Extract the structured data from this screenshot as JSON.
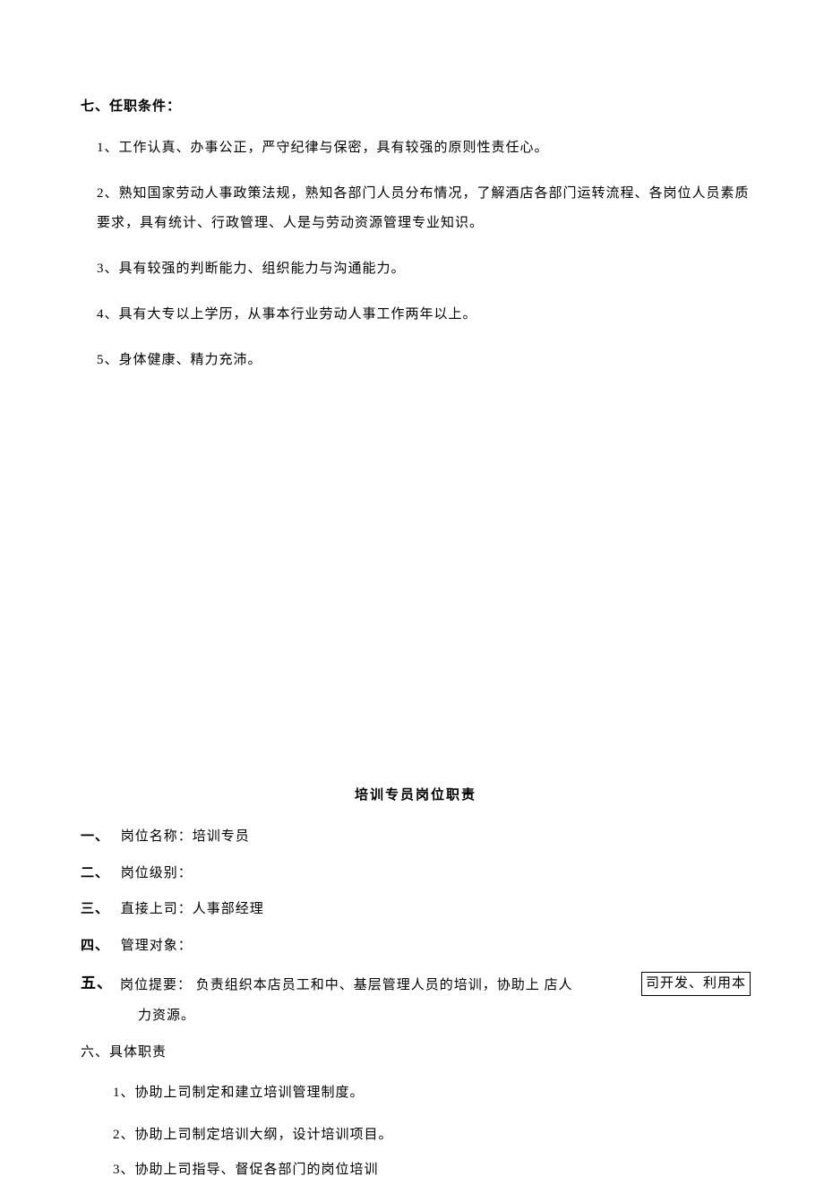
{
  "section1": {
    "heading": "七、任职条件：",
    "items": [
      "1、工作认真、办事公正，严守纪律与保密，具有较强的原则性责任心。",
      "2、熟知国家劳动人事政策法规，熟知各部门人员分布情况，了解酒店各部门运转流程、各岗位人员素质要求，具有统计、行政管理、人是与劳动资源管理专业知识。",
      "3、具有较强的判断能力、组织能力与沟通能力。",
      "4、具有大专以上学历，从事本行业劳动人事工作两年以上。",
      "5、身体健康、精力充沛。"
    ]
  },
  "title": "培训专员岗位职责",
  "outline": {
    "one": {
      "num": "一、",
      "text": "岗位名称：培训专员"
    },
    "two": {
      "num": "二、",
      "text": "岗位级别："
    },
    "three": {
      "num": "三、",
      "text": "直接上司：人事部经理"
    },
    "four": {
      "num": "四、",
      "text": "管理对象："
    },
    "five": {
      "num": "五、",
      "label": "岗位提要：",
      "text": "负责组织本店员工和中、基层管理人员的培训，协助上 店人",
      "boxed": "司开发、利用本",
      "cont": "力资源。"
    },
    "six": {
      "num": "六、",
      "text": "具体职责"
    }
  },
  "sublist": {
    "items": [
      "1、协助上司制定和建立培训管理制度。",
      "2、协助上司制定培训大纲，设计培训项目。",
      "3、协助上司指导、督促各部门的岗位培训"
    ]
  }
}
